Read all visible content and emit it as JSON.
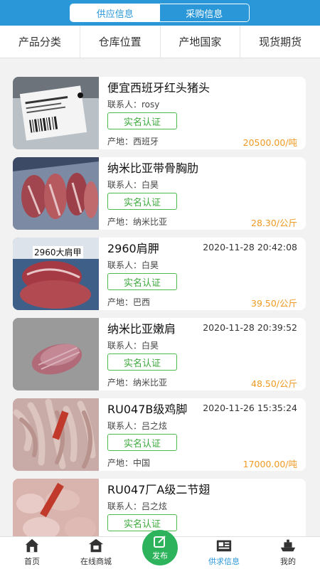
{
  "header": {
    "tabs": [
      {
        "label": "供应信息"
      },
      {
        "label": "采购信息"
      }
    ]
  },
  "filters": [
    "产品分类",
    "仓库位置",
    "产地国家",
    "现货期货"
  ],
  "listings": [
    {
      "title": "便宜西班牙红头猪头",
      "date": "",
      "contact": "联系人：rosy",
      "badge": "实名认证",
      "origin": "产地：西班牙",
      "price": "20500.00/吨"
    },
    {
      "title": "纳米比亚带骨胸肋",
      "date": "",
      "contact": "联系人：白昊",
      "badge": "实名认证",
      "origin": "产地：纳米比亚",
      "price": "28.30/公斤"
    },
    {
      "title": "2960肩胛",
      "date": "2020-11-28 20:42:08",
      "contact": "联系人：白昊",
      "badge": "实名认证",
      "origin": "产地：巴西",
      "price": "39.50/公斤",
      "thumb_label": "2960大肩甲"
    },
    {
      "title": "纳米比亚嫩肩",
      "date": "2020-11-28 20:39:52",
      "contact": "联系人：白昊",
      "badge": "实名认证",
      "origin": "产地：纳米比亚",
      "price": "48.50/公斤"
    },
    {
      "title": "RU047B级鸡脚",
      "date": "2020-11-26 15:35:24",
      "contact": "联系人：吕之炫",
      "badge": "实名认证",
      "origin": "产地：中国",
      "price": "17000.00/吨"
    },
    {
      "title": "RU047厂A级二节翅",
      "date": "",
      "contact": "联系人：吕之炫",
      "badge": "实名认证",
      "origin": "",
      "price": ""
    }
  ],
  "nav": [
    {
      "label": "首页",
      "icon": "home-icon"
    },
    {
      "label": "在线商城",
      "icon": "store-icon"
    },
    {
      "label": "发布",
      "icon": "publish-icon"
    },
    {
      "label": "供求信息",
      "icon": "supply-demand-icon"
    },
    {
      "label": "我的",
      "icon": "profile-icon"
    }
  ],
  "colors": {
    "primary": "#2a98d8",
    "badge_green": "#3aa83a",
    "price_orange": "#f09a22",
    "publish_green": "#2db35b"
  }
}
